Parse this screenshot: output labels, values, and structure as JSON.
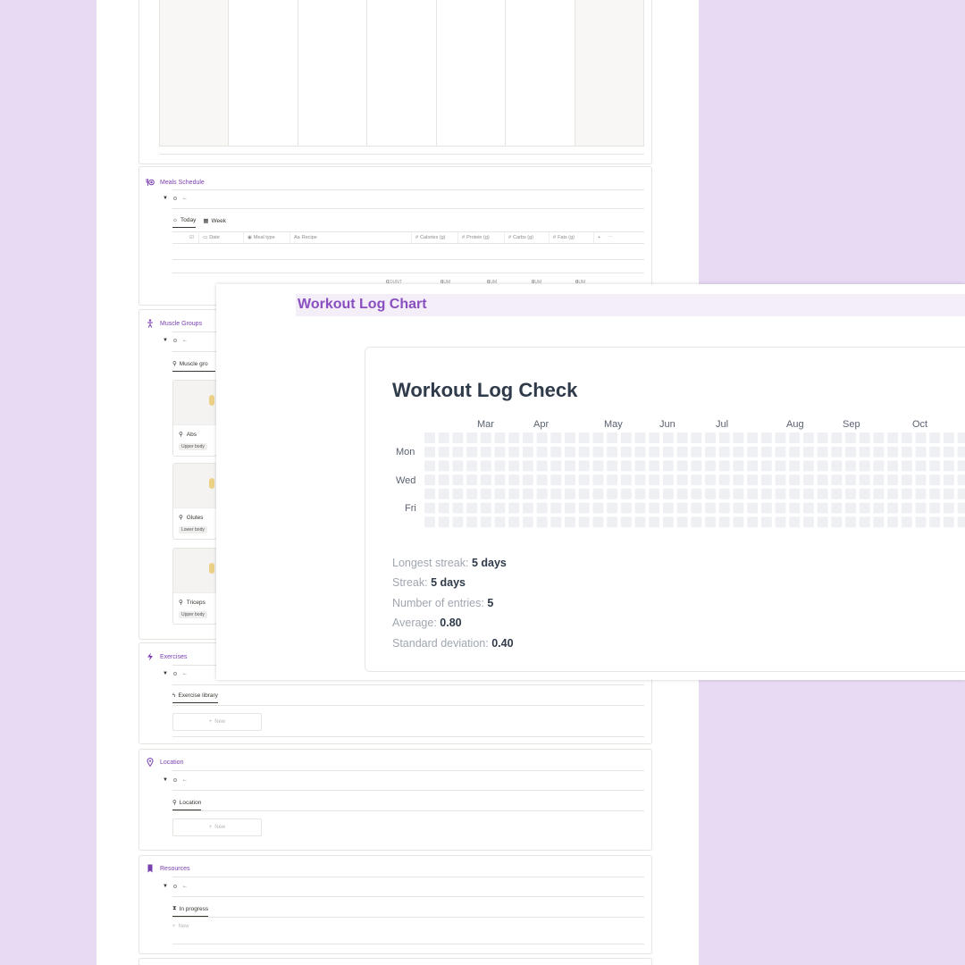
{
  "colors": {
    "background": "#e8daf3",
    "accent": "#7b3fb0",
    "overlay_title": "#8a4fc0",
    "heat_cell": "#eef0f4"
  },
  "meals": {
    "title": "Meals Schedule",
    "icon": "utensils-icon",
    "tabs": [
      {
        "label": "Today",
        "icon": "sun-icon"
      },
      {
        "label": "Week",
        "icon": "calendar-icon"
      }
    ],
    "columns": [
      "Date",
      "Meal type",
      "Recipe",
      "Calories (g)",
      "Protein (g)",
      "Carbs (g)",
      "Fats (g)"
    ],
    "sums": [
      {
        "label": "COUNT",
        "value": "0"
      },
      {
        "label": "SUM",
        "value": "0"
      },
      {
        "label": "SUM",
        "value": "0"
      },
      {
        "label": "SUM",
        "value": "0"
      },
      {
        "label": "SUM",
        "value": "0"
      }
    ]
  },
  "muscle": {
    "title": "Muscle Groups",
    "icon": "person-icon",
    "tab": "Muscle gro",
    "cards": [
      {
        "name": "Abs",
        "tag": "Upper body"
      },
      {
        "name": "Glutes",
        "tag": "Lower body"
      },
      {
        "name": "Triceps",
        "tag": "Upper body"
      }
    ]
  },
  "exercises": {
    "title": "Exercises",
    "icon": "bolt-icon",
    "tab": "Exercise library",
    "new_label": "New"
  },
  "location": {
    "title": "Location",
    "icon": "pin-icon",
    "tab": "Location",
    "new_label": "New"
  },
  "resources": {
    "title": "Resources",
    "icon": "bookmark-icon",
    "tab": "In progress",
    "new_label": "New"
  },
  "workout": {
    "window_title": "Workout Log Chart",
    "heading": "Workout Log Check",
    "months": [
      "Mar",
      "Apr",
      "May",
      "Jun",
      "Jul",
      "Aug",
      "Sep",
      "Oct"
    ],
    "days": [
      "Mon",
      "Wed",
      "Fri"
    ],
    "stats": [
      {
        "label": "Longest streak:",
        "value": "5 days"
      },
      {
        "label": "Streak:",
        "value": "5 days"
      },
      {
        "label": "Number of entries:",
        "value": "5"
      },
      {
        "label": "Average:",
        "value": "0.80"
      },
      {
        "label": "Standard deviation:",
        "value": "0.40"
      }
    ]
  }
}
